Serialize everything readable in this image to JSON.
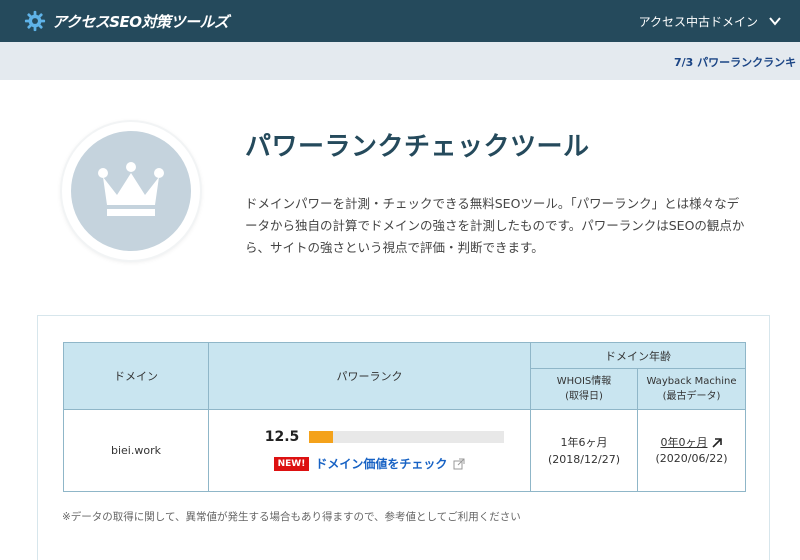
{
  "header": {
    "logo_text": "アクセスSEO対策ツールズ",
    "logo_icon": "gear-icon",
    "domain_menu_label": "アクセス中古ドメイン",
    "domain_menu_icon": "chevron-down-icon",
    "bg_color": "#254a5c"
  },
  "ticker": {
    "text": "7/3 パワーランクランキ"
  },
  "hero": {
    "icon": "crown-icon",
    "title": "パワーランクチェックツール",
    "description": "ドメインパワーを計測・チェックできる無料SEOツール。「パワーランク」とは様々なデータから独自の計算でドメインの強さを計測したものです。パワーランクはSEOの観点から、サイトの強さという視点で評価・判断できます。"
  },
  "table": {
    "headers": {
      "domain": "ドメイン",
      "power_rank": "パワーランク",
      "domain_age": "ドメイン年齢",
      "whois_line1": "WHOIS情報",
      "whois_line2": "(取得日)",
      "wayback_line1": "Wayback Machine",
      "wayback_line2": "(最古データ)"
    },
    "rows": [
      {
        "domain": "biei.work",
        "rank": "12.5",
        "rank_fraction": 0.12,
        "new_badge": "NEW!",
        "check_link": "ドメイン価値をチェック",
        "whois_age": "1年6ヶ月",
        "whois_date": "(2018/12/27)",
        "wayback_age": "0年0ヶ月",
        "wayback_date": "(2020/06/22)"
      }
    ]
  },
  "note": "※データの取得に関して、異常値が発生する場合もあり得ますので、参考値としてご利用ください",
  "colors": {
    "accent": "#254a5c",
    "bar_fill": "#f4a21b",
    "link": "#1762c4",
    "badge": "#dd1111",
    "table_header": "#c9e5f0"
  }
}
